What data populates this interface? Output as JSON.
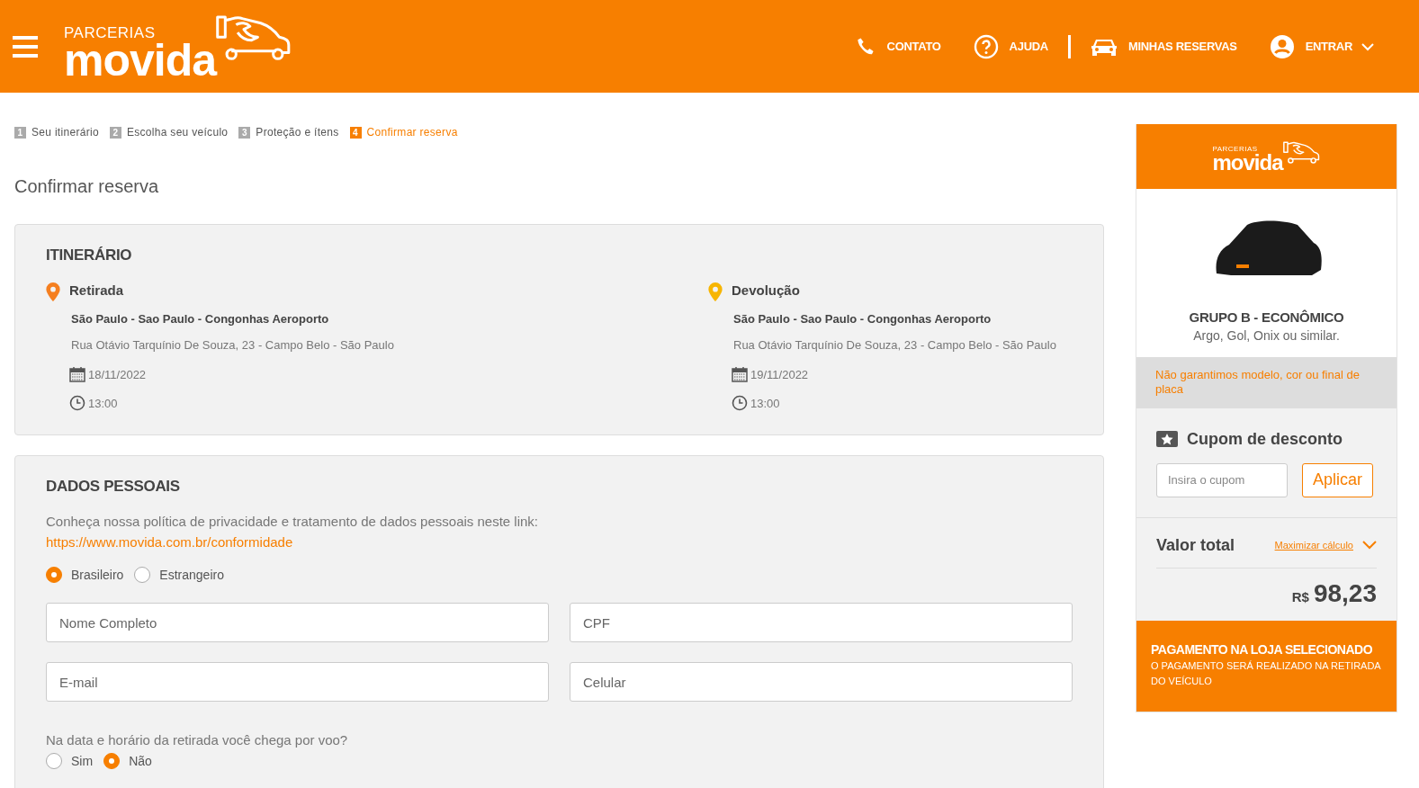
{
  "header": {
    "logo": {
      "small": "PARCERIAS",
      "big": "movida"
    },
    "nav": [
      {
        "kind": "phone",
        "label": "CONTATO"
      },
      {
        "kind": "help",
        "label": "AJUDA"
      },
      {
        "kind": "car",
        "label": "MINHAS RESERVAS"
      },
      {
        "kind": "user",
        "label": "ENTRAR"
      }
    ]
  },
  "steps": [
    {
      "number": "1",
      "label": "Seu itinerário",
      "selected": false
    },
    {
      "number": "2",
      "label": "Escolha seu veículo",
      "selected": false
    },
    {
      "number": "3",
      "label": "Proteção e ítens",
      "selected": false
    },
    {
      "number": "4",
      "label": "Confirmar reserva",
      "selected": true
    }
  ],
  "page_title": "Confirmar reserva",
  "itinerary": {
    "title": "ITINERÁRIO",
    "locations": [
      {
        "label": "Retirada",
        "color": "#f57f20",
        "store": "São Paulo - Sao Paulo - Congonhas Aeroporto",
        "address": "Rua Otávio Tarquínio De Souza, 23 - Campo Belo - São Paulo",
        "date": "18/11/2022",
        "time": "13:00"
      },
      {
        "label": "Devolução",
        "color": "#f7b500",
        "store": "São Paulo - Sao Paulo - Congonhas Aeroporto",
        "address": "Rua Otávio Tarquínio De Souza, 23 - Campo Belo - São Paulo",
        "date": "19/11/2022",
        "time": "13:00"
      }
    ]
  },
  "personal": {
    "title": "DADOS PESSOAIS",
    "privacy_text": "Conheça nossa política de privacidade e tratamento de dados pessoais neste link:",
    "privacy_link": "https://www.movida.com.br/conformidade",
    "nationality": [
      {
        "label": "Brasileiro",
        "selected": true
      },
      {
        "label": "Estrangeiro",
        "selected": false
      }
    ],
    "fields": [
      {
        "placeholder": "Nome Completo"
      },
      {
        "placeholder": "CPF"
      },
      {
        "placeholder": "E-mail"
      },
      {
        "placeholder": "Celular"
      }
    ],
    "flight_question": "Na data e horário da retirada você chega por voo?",
    "flight": [
      {
        "label": "Sim",
        "selected": false
      },
      {
        "label": "Não",
        "selected": true
      }
    ]
  },
  "summary": {
    "logo": {
      "small": "PARCERIAS",
      "big": "movida"
    },
    "group": "GRUPO B - ECONÔMICO",
    "models": "Argo, Gol, Onix ou similar.",
    "notice": "Não garantimos modelo, cor ou final de placa",
    "coupon": {
      "title": "Cupom de desconto",
      "placeholder": "Insira o cupom",
      "button": "Aplicar"
    },
    "total": {
      "label": "Valor total",
      "toggle": "Maximizar cálculo",
      "currency": "R$",
      "amount": "98,23"
    },
    "payment": {
      "title": "PAGAMENTO NA LOJA SELECIONADO",
      "subtitle": "O PAGAMENTO SERÁ REALIZADO NA RETIRADA DO VEÍCULO"
    }
  }
}
